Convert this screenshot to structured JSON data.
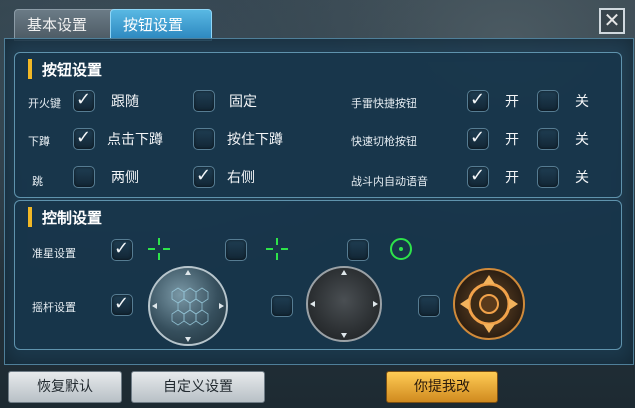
{
  "tabs": {
    "basic_settings": "基本设置",
    "button_settings": "按钮设置"
  },
  "close_icon": "✕",
  "sections": {
    "button_settings_title": "按钮设置",
    "control_settings_title": "控制设置"
  },
  "rows": {
    "fire_key": {
      "label": "开火键",
      "option_follow": "跟随",
      "option_fixed": "固定",
      "follow_checked": true,
      "fixed_checked": false
    },
    "crouch": {
      "label": "下蹲",
      "option_click": "点击下蹲",
      "option_hold": "按住下蹲",
      "click_checked": true,
      "hold_checked": false
    },
    "jump": {
      "label": "跳",
      "option_both_sides": "两侧",
      "option_right_side": "右侧",
      "both_checked": false,
      "right_checked": true
    },
    "grenade_shortcut": {
      "label": "手雷快捷按钮",
      "option_on": "开",
      "option_off": "关",
      "on_checked": true,
      "off_checked": false
    },
    "quick_switch_gun": {
      "label": "快速切枪按钮",
      "option_on": "开",
      "option_off": "关",
      "on_checked": true,
      "off_checked": false
    },
    "auto_voice_in_combat": {
      "label": "战斗内自动语音",
      "option_on": "开",
      "option_off": "关",
      "on_checked": true,
      "off_checked": false
    }
  },
  "control": {
    "crosshair_settings": "准星设置",
    "joystick_settings": "摇杆设置"
  },
  "buttons": {
    "restore_default": "恢复默认",
    "customize": "自定义设置",
    "suggest": "你提我改"
  },
  "colors": {
    "active_tab": "#2b86be",
    "accent_gold": "#f1b826",
    "crosshair_green": "#2ee34a"
  }
}
